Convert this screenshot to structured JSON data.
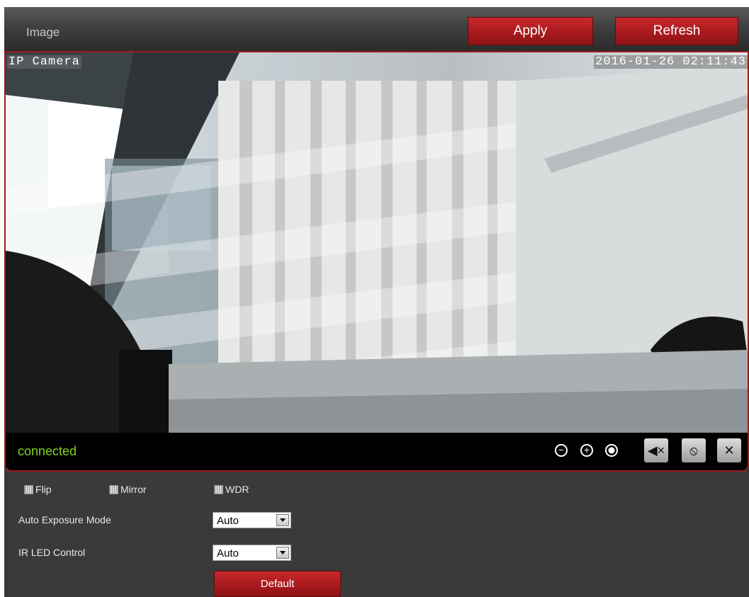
{
  "header": {
    "title": "Image",
    "apply_label": "Apply",
    "refresh_label": "Refresh"
  },
  "video": {
    "osd_name": "IP Camera",
    "osd_timestamp": "2016-01-26 02:11:43",
    "status": "connected",
    "controls": [
      "zoom-out-icon",
      "zoom-in-icon",
      "record-icon",
      "mute-icon",
      "mic-off-icon",
      "settings-tools-icon"
    ]
  },
  "settings": {
    "checkboxes": [
      {
        "label": "Flip"
      },
      {
        "label": "Mirror"
      },
      {
        "label": "WDR"
      }
    ],
    "auto_exposure_label": "Auto Exposure Mode",
    "auto_exposure_value": "Auto",
    "ir_led_label": "IR LED Control",
    "ir_led_value": "Auto",
    "default_label": "Default"
  },
  "colors": {
    "accent_red": "#a81a1e",
    "status_green": "#7ed321",
    "panel_bg": "#3a3a3a"
  }
}
